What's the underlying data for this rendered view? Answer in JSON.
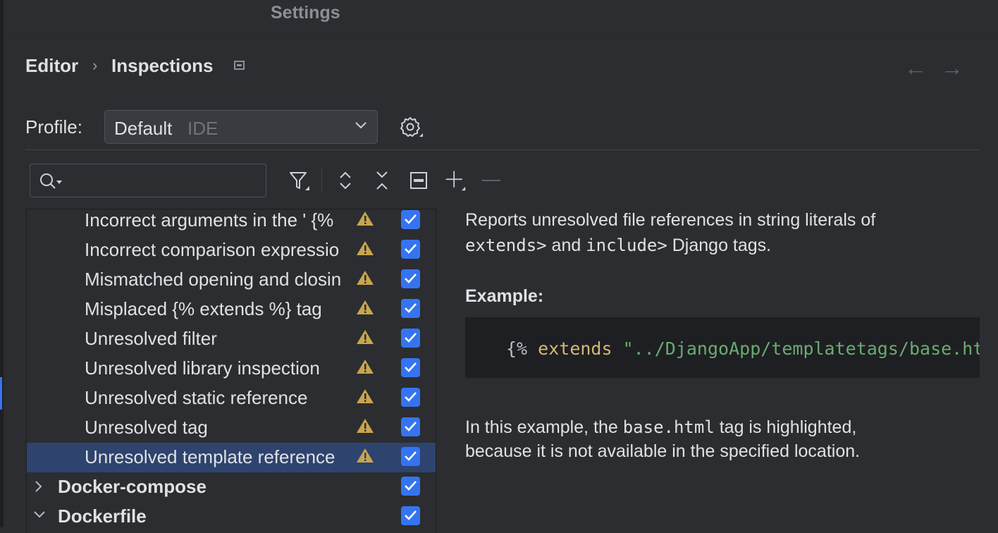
{
  "window": {
    "title": "Settings"
  },
  "breadcrumb": {
    "parent": "Editor",
    "separator": "›",
    "current": "Inspections"
  },
  "nav": {
    "back": "←",
    "forward": "→"
  },
  "profile": {
    "label": "Profile:",
    "value": "Default",
    "scope": "IDE"
  },
  "search": {
    "placeholder": ""
  },
  "toolbar": {
    "icons": [
      "filter-icon",
      "expand-all-icon",
      "collapse-all-icon",
      "hide-icon",
      "add-icon",
      "remove-icon"
    ]
  },
  "tree": {
    "rows": [
      {
        "label": "Incorrect arguments in the ' {% ",
        "severity": "warning",
        "checked": true,
        "selected": false
      },
      {
        "label": "Incorrect comparison expressio",
        "severity": "warning",
        "checked": true,
        "selected": false
      },
      {
        "label": "Mismatched opening and closin",
        "severity": "warning",
        "checked": true,
        "selected": false
      },
      {
        "label": "Misplaced {% extends %} tag",
        "severity": "warning",
        "checked": true,
        "selected": false
      },
      {
        "label": "Unresolved filter",
        "severity": "warning",
        "checked": true,
        "selected": false
      },
      {
        "label": "Unresolved library inspection",
        "severity": "warning",
        "checked": true,
        "selected": false
      },
      {
        "label": "Unresolved static reference",
        "severity": "warning",
        "checked": true,
        "selected": false
      },
      {
        "label": "Unresolved tag",
        "severity": "warning",
        "checked": true,
        "selected": false
      },
      {
        "label": "Unresolved template reference",
        "severity": "warning",
        "checked": true,
        "selected": true
      }
    ],
    "groups": [
      {
        "label": "Docker-compose",
        "expanded": false,
        "checked": true
      },
      {
        "label": "Dockerfile",
        "expanded": true,
        "checked": true
      }
    ]
  },
  "description": {
    "line1": "Reports unresolved file references in string literals of",
    "line2_code1": "extends>",
    "line2_mid": " and ",
    "line2_code2": "include>",
    "line2_end": " Django tags.",
    "example_title": "Example:",
    "code_open": "{%",
    "code_kw": " extends ",
    "code_str": "\"../DjangoApp/templatetags/base.html\" %}",
    "note1_start": "In this example, the ",
    "note1_code": "base.html",
    "note1_end": " tag is highlighted,",
    "note2": "because it is not available in the specified location."
  },
  "colors": {
    "background": "#2b2d30",
    "accent": "#3574f0",
    "selection": "#2e436e",
    "warning": "#c9a54d",
    "code_keyword": "#d5b778",
    "code_string": "#6aab73"
  }
}
